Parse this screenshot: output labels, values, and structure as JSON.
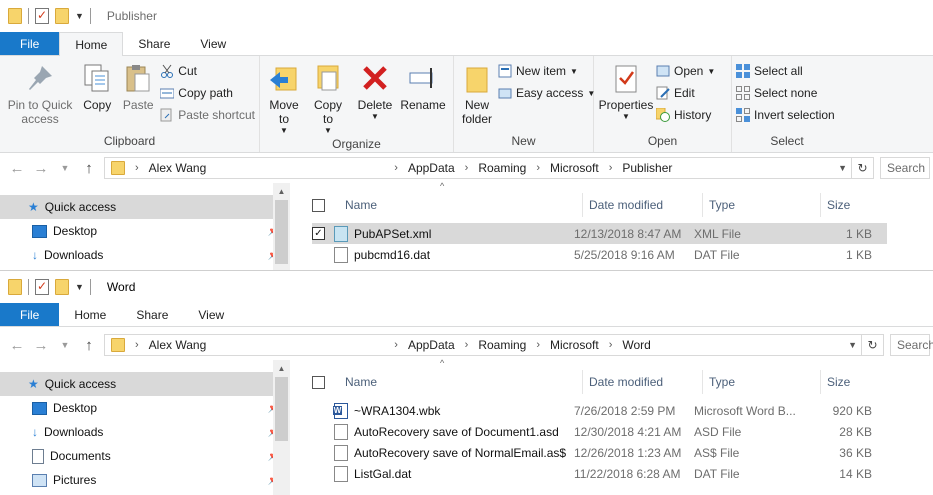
{
  "win1": {
    "title": "Publisher",
    "tabs": {
      "file": "File",
      "home": "Home",
      "share": "Share",
      "view": "View"
    },
    "ribbon": {
      "clipboard": {
        "label": "Clipboard",
        "pin": "Pin to Quick access",
        "copy": "Copy",
        "paste": "Paste",
        "cut": "Cut",
        "copy_path": "Copy path",
        "paste_shortcut": "Paste shortcut"
      },
      "organize": {
        "label": "Organize",
        "move_to": "Move to",
        "copy_to": "Copy to",
        "delete": "Delete",
        "rename": "Rename"
      },
      "new": {
        "label": "New",
        "new_folder": "New folder",
        "new_item": "New item",
        "easy_access": "Easy access"
      },
      "open": {
        "label": "Open",
        "properties": "Properties",
        "open": "Open",
        "edit": "Edit",
        "history": "History"
      },
      "select": {
        "label": "Select",
        "select_all": "Select all",
        "select_none": "Select none",
        "invert": "Invert selection"
      }
    },
    "address": {
      "root": "Alex Wang",
      "p1": "AppData",
      "p2": "Roaming",
      "p3": "Microsoft",
      "p4": "Publisher"
    },
    "search_placeholder": "Search",
    "nav": {
      "quick_access": "Quick access",
      "desktop": "Desktop",
      "downloads": "Downloads"
    },
    "columns": {
      "name": "Name",
      "date": "Date modified",
      "type": "Type",
      "size": "Size"
    },
    "files": [
      {
        "name": "PubAPSet.xml",
        "date": "12/13/2018 8:47 AM",
        "type": "XML File",
        "size": "1 KB"
      },
      {
        "name": "pubcmd16.dat",
        "date": "5/25/2018 9:16 AM",
        "type": "DAT File",
        "size": "1 KB"
      }
    ]
  },
  "win2": {
    "title": "Word",
    "tabs": {
      "file": "File",
      "home": "Home",
      "share": "Share",
      "view": "View"
    },
    "address": {
      "root": "Alex Wang",
      "p1": "AppData",
      "p2": "Roaming",
      "p3": "Microsoft",
      "p4": "Word"
    },
    "search_placeholder": "Search",
    "nav": {
      "quick_access": "Quick access",
      "desktop": "Desktop",
      "downloads": "Downloads",
      "documents": "Documents",
      "pictures": "Pictures"
    },
    "columns": {
      "name": "Name",
      "date": "Date modified",
      "type": "Type",
      "size": "Size"
    },
    "files": [
      {
        "name": "~WRA1304.wbk",
        "date": "7/26/2018 2:59 PM",
        "type": "Microsoft Word B...",
        "size": "920 KB"
      },
      {
        "name": "AutoRecovery save of Document1.asd",
        "date": "12/30/2018 4:21 AM",
        "type": "ASD File",
        "size": "28 KB"
      },
      {
        "name": "AutoRecovery save of NormalEmail.as$",
        "date": "12/26/2018 1:23 AM",
        "type": "AS$ File",
        "size": "36 KB"
      },
      {
        "name": "ListGal.dat",
        "date": "11/22/2018 6:28 AM",
        "type": "DAT File",
        "size": "14 KB"
      }
    ]
  }
}
